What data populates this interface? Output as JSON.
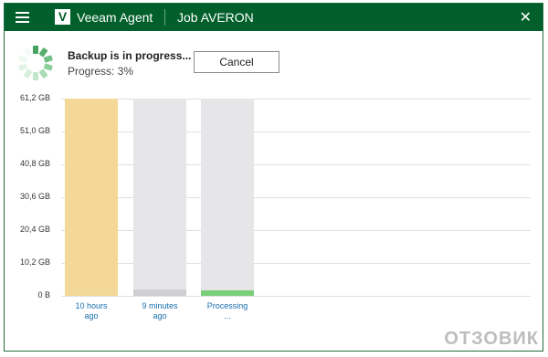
{
  "window": {
    "app_title": "Veeam Agent",
    "logo_letter": "V",
    "job_title": "Job AVERON",
    "close_glyph": "✕"
  },
  "status": {
    "title": "Backup is in progress...",
    "progress_label": "Progress: 3%",
    "progress_fraction": 0.03,
    "cancel_label": "Cancel"
  },
  "chart_data": {
    "type": "bar",
    "ylim": [
      0,
      61.2
    ],
    "y_unit": "GB",
    "y_ticks": [
      {
        "value": 61.2,
        "label": "61,2 GB"
      },
      {
        "value": 51.0,
        "label": "51,0 GB"
      },
      {
        "value": 40.8,
        "label": "40,8 GB"
      },
      {
        "value": 30.6,
        "label": "30,6 GB"
      },
      {
        "value": 20.4,
        "label": "20,4 GB"
      },
      {
        "value": 10.2,
        "label": "10,2 GB"
      },
      {
        "value": 0,
        "label": "0 B"
      }
    ],
    "categories": [
      "10 hours ago",
      "9 minutes ago",
      "Processing ..."
    ],
    "category_lines": [
      [
        "10 hours",
        "ago"
      ],
      [
        "9 minutes",
        "ago"
      ],
      [
        "Processing",
        "..."
      ]
    ],
    "values": [
      61.2,
      2.0,
      1.7
    ],
    "colors": [
      "#f4d898",
      "#cfcfd2",
      "#7ccf7a"
    ],
    "background_color": "#e6e5e8",
    "grid": true
  },
  "watermark": "ОТЗОВИК"
}
